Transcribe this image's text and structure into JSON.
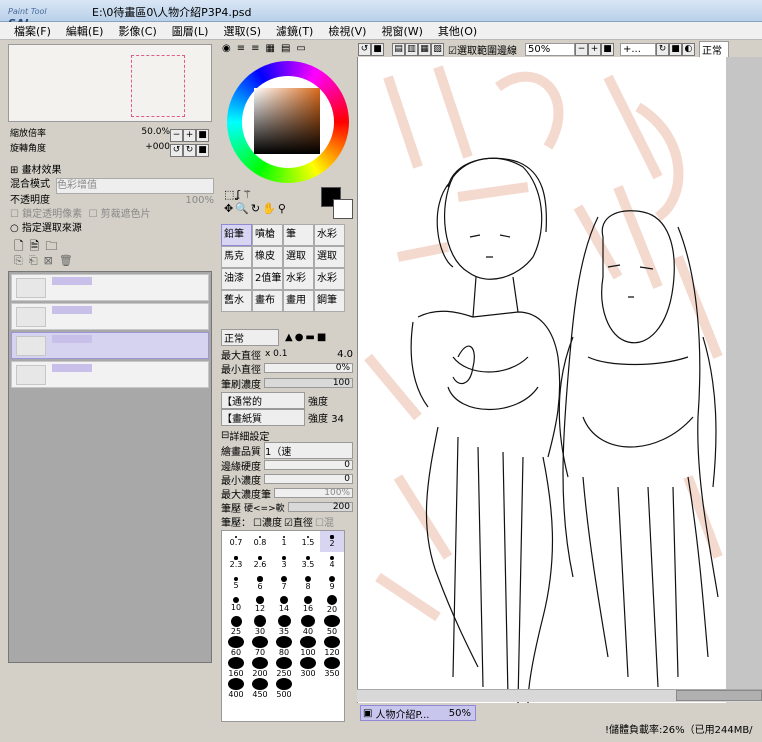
{
  "window": {
    "logo_small": "Paint Tool",
    "logo": "SAI",
    "file_path": "E:\\0待畫區0\\人物介紹P3P4.psd"
  },
  "menu": [
    "檔案(F)",
    "編輯(E)",
    "影像(C)",
    "圖層(L)",
    "選取(S)",
    "濾鏡(T)",
    "檢視(V)",
    "視窗(W)",
    "其他(O)"
  ],
  "navigator": {
    "zoom_label": "縮放倍率",
    "zoom_value": "50.0%",
    "angle_label": "旋轉角度",
    "angle_value": "+000"
  },
  "layer_panel": {
    "texture_effect": "畫材效果",
    "blend_label": "混合模式",
    "blend_value": "色彩增值",
    "opacity_label": "不透明度",
    "opacity_value": "100%",
    "protect_alpha": "鎖定透明像素",
    "clipping": "剪裁遮色片",
    "selection_source": "指定選取來源",
    "layers": [
      {
        "name": "",
        "selected": false
      },
      {
        "name": "",
        "selected": false
      },
      {
        "name": "",
        "selected": true
      },
      {
        "name": "",
        "selected": false
      }
    ]
  },
  "tools": {
    "brushes": [
      "鉛筆",
      "噴槍",
      "筆",
      "水彩",
      "馬克",
      "橡皮",
      "選取",
      "選取",
      "油漆",
      "2值筆",
      "水彩",
      "水彩",
      "舊水",
      "畫布",
      "畫用",
      "鋼筆"
    ],
    "blend_mode": "正常",
    "max_size_label": "最大直徑",
    "max_size_mult": "x 0.1",
    "max_size_value": "4.0",
    "min_size_label": "最小直徑",
    "min_size_value": "0%",
    "density_label": "筆刷濃度",
    "density_value": "100",
    "shape_select": "【通常的",
    "shape_strength": "強度",
    "shape_strength_value": "",
    "texture_select": "【畫紙質",
    "texture_strength": "強度",
    "texture_strength_value": "34",
    "detail_header": "詳細設定",
    "quality_label": "繪畫品質",
    "quality_value": "1（速",
    "edge_hardness_label": "邊緣硬度",
    "edge_hardness_value": "0",
    "min_density_label": "最小濃度",
    "min_density_value": "0",
    "max_density_pressure_label": "最大濃度筆",
    "max_density_pressure_value": "100%",
    "pen_pressure_label": "筆壓",
    "pen_pressure_mid": "硬<=>軟",
    "pen_pressure_value": "200",
    "pressure_label": "筆壓：",
    "pressure_density": "濃度",
    "pressure_size": "直徑",
    "pressure_blend": "混",
    "brush_sizes": [
      "0.7",
      "0.8",
      "1",
      "1.5",
      "2",
      "2.3",
      "2.6",
      "3",
      "3.5",
      "4",
      "5",
      "6",
      "7",
      "8",
      "9",
      "10",
      "12",
      "14",
      "16",
      "20",
      "25",
      "30",
      "35",
      "40",
      "50",
      "60",
      "70",
      "80",
      "100",
      "120",
      "160",
      "200",
      "250",
      "300",
      "350",
      "400",
      "450",
      "500",
      "",
      ""
    ]
  },
  "canvas_toolbar": {
    "anti_alias_label": "選取範圍邊線",
    "zoom": "50%",
    "angle": "+...",
    "mode": "正常"
  },
  "status": {
    "doc_tab": "人物介紹P...",
    "doc_zoom": "50%",
    "memory": "!儲體負載率:26%（已用244MB/"
  }
}
